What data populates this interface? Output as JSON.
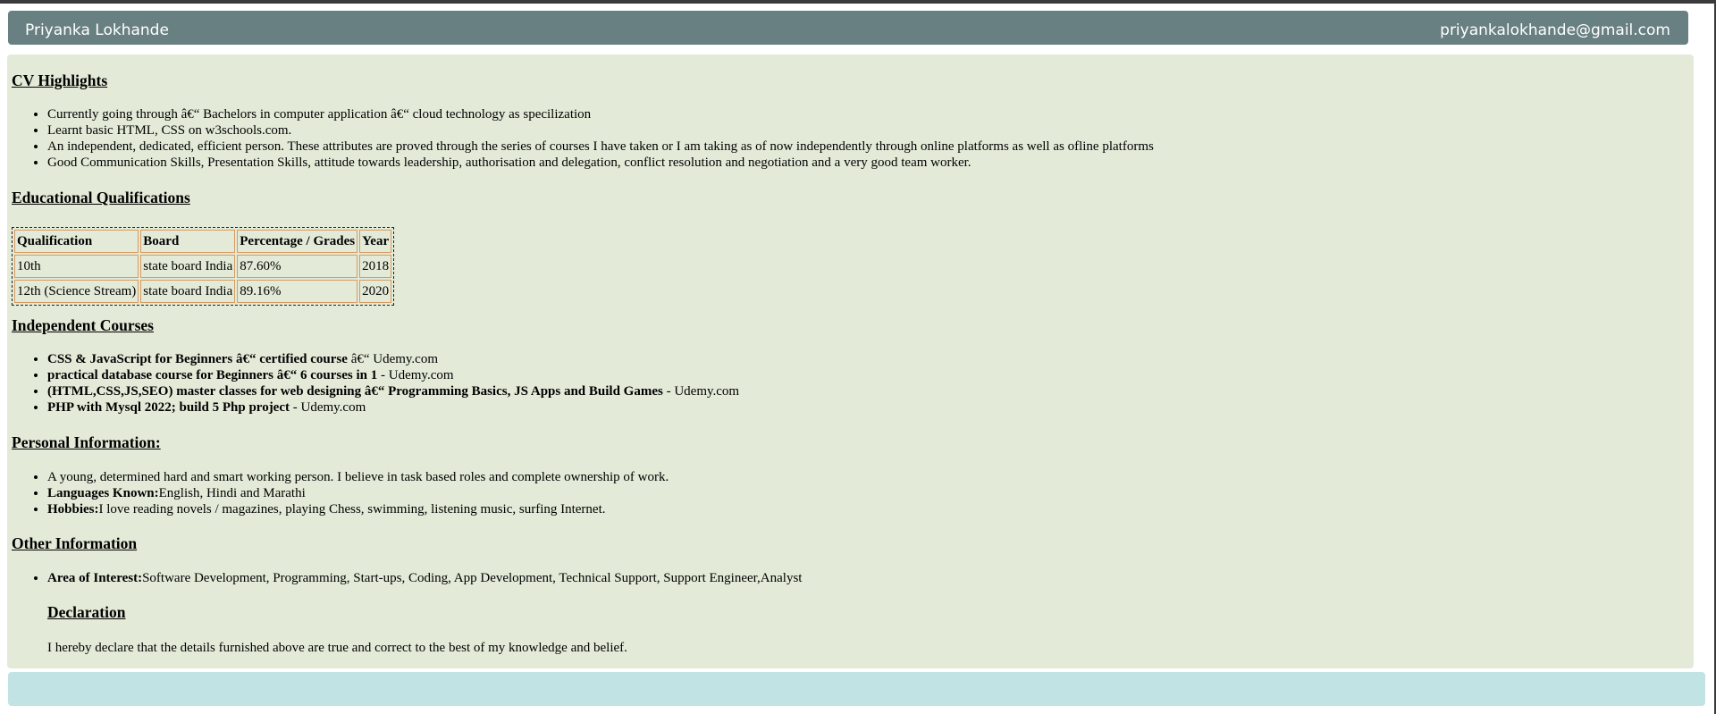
{
  "header": {
    "name": "Priyanka Lokhande",
    "email": "priyankalokhande@gmail.com"
  },
  "cv_highlights": {
    "title": "CV Highlights",
    "items": [
      "Currently going through â€“ Bachelors in computer application â€“ cloud technology as specilization",
      "Learnt basic HTML, CSS on w3schools.com.",
      "An independent, dedicated, efficient person. These attributes are proved through the series of courses I have taken or I am taking as of now independently through online platforms as well as ofline platforms",
      "Good Communication Skills, Presentation Skills, attitude towards leadership, authorisation and delegation, conflict resolution and negotiation and a very good team worker."
    ]
  },
  "education": {
    "title": "Educational Qualifications",
    "headers": [
      "Qualification",
      "Board",
      "Percentage / Grades",
      "Year"
    ],
    "rows": [
      [
        "10th",
        "state board India",
        "87.60%",
        "2018"
      ],
      [
        "12th (Science Stream)",
        "state board India",
        "89.16%",
        "2020"
      ]
    ]
  },
  "courses": {
    "title": "Independent Courses",
    "items": [
      {
        "bold": "CSS & JavaScript for Beginners â€“ certified course",
        "rest": " â€“ Udemy.com"
      },
      {
        "bold": "practical database course for Beginners â€“ 6 courses in 1",
        "rest": " - Udemy.com"
      },
      {
        "bold": "(HTML,CSS,JS,SEO) master classes for web designing â€“ Programming Basics, JS Apps and Build Games",
        "rest": " - Udemy.com"
      },
      {
        "bold": "PHP with Mysql 2022; build 5 Php project",
        "rest": " - Udemy.com"
      }
    ]
  },
  "personal": {
    "title": "Personal Information:",
    "statement": "A young, determined hard and smart working person. I believe in task based roles and complete ownership of work.",
    "languages_label": "Languages Known:",
    "languages_value": "English, Hindi and Marathi",
    "hobbies_label": "Hobbies:",
    "hobbies_value": "I love reading novels / magazines, playing Chess, swimming, listening music, surfing Internet."
  },
  "other": {
    "title": "Other Information",
    "interest_label": "Area of Interest:",
    "interest_value": "Software Development, Programming, Start-ups, Coding, App Development, Technical Support, Support Engineer,Analyst"
  },
  "declaration": {
    "title": "Declaration",
    "text": "I hereby declare that the details furnished above are true and correct to the best of my knowledge and belief."
  },
  "colors": {
    "header_bg": "#698083",
    "content_bg": "#e3ebd8",
    "footer_bg": "#c1e3e3",
    "table_cell_border": "#d79a61"
  }
}
